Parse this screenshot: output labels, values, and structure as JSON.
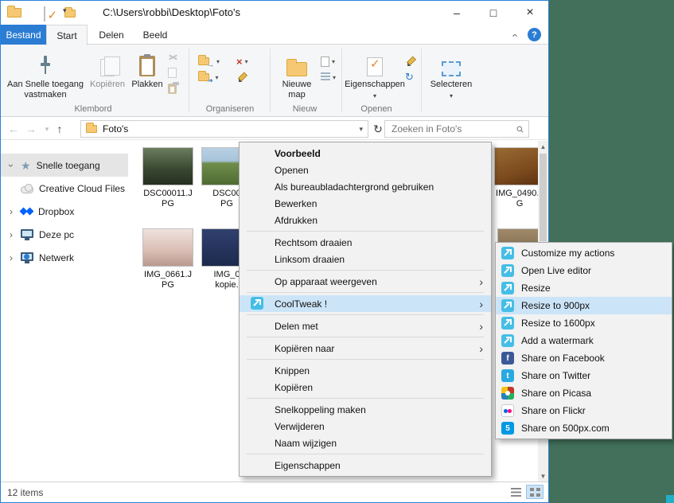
{
  "colors": {
    "accent_blue": "#2b7cd3",
    "desktop_green": "#42705a",
    "menu_highlight": "#cce4f7",
    "cooltweak_teal": "#45bee6"
  },
  "window": {
    "title": "C:\\Users\\robbi\\Desktop\\Foto's"
  },
  "tabs": [
    "Bestand",
    "Start",
    "Delen",
    "Beeld"
  ],
  "ribbon": {
    "pin": "Aan Snelle toegang vastmaken",
    "copy": "Kopiëren",
    "paste": "Plakken",
    "new_folder": "Nieuwe map",
    "properties": "Eigenschappen",
    "select": "Selecteren",
    "group_clipboard": "Klembord",
    "group_organize": "Organiseren",
    "group_new": "Nieuw",
    "group_open": "Openen"
  },
  "addressbar": {
    "location": "Foto's",
    "search_placeholder": "Zoeken in Foto's"
  },
  "sidebar": {
    "items": [
      {
        "label": "Snelle toegang"
      },
      {
        "label": "Creative Cloud Files"
      },
      {
        "label": "Dropbox"
      },
      {
        "label": "Deze pc"
      },
      {
        "label": "Netwerk"
      }
    ]
  },
  "files": [
    {
      "line1": "DSC00011.J",
      "line2": "PG"
    },
    {
      "line1": "DSC00",
      "line2": "PG"
    },
    {
      "line1": "IMG_0490.J",
      "line2": "G"
    },
    {
      "line1": "IMG_0661.J",
      "line2": "PG"
    },
    {
      "line1": "IMG_0",
      "line2": "kopie."
    }
  ],
  "context_menu": {
    "items": [
      {
        "label": "Voorbeeld"
      },
      {
        "label": "Openen"
      },
      {
        "label": "Als bureaubladachtergrond gebruiken"
      },
      {
        "label": "Bewerken"
      },
      {
        "label": "Afdrukken"
      },
      {
        "label": "Rechtsom draaien"
      },
      {
        "label": "Linksom draaien"
      },
      {
        "label": "Op apparaat weergeven"
      },
      {
        "label": "CoolTweak !"
      },
      {
        "label": "Delen met"
      },
      {
        "label": "Kopiëren naar"
      },
      {
        "label": "Knippen"
      },
      {
        "label": "Kopiëren"
      },
      {
        "label": "Snelkoppeling maken"
      },
      {
        "label": "Verwijderen"
      },
      {
        "label": "Naam wijzigen"
      },
      {
        "label": "Eigenschappen"
      }
    ]
  },
  "submenu": {
    "items": [
      {
        "label": "Customize my actions",
        "icon": "cooltweak-icon"
      },
      {
        "label": "Open Live editor",
        "icon": "cooltweak-icon"
      },
      {
        "label": "Resize",
        "icon": "cooltweak-icon"
      },
      {
        "label": "Resize to 900px",
        "icon": "cooltweak-icon"
      },
      {
        "label": "Resize to 1600px",
        "icon": "cooltweak-icon"
      },
      {
        "label": "Add a watermark",
        "icon": "cooltweak-icon"
      },
      {
        "label": "Share on Facebook",
        "icon": "facebook-icon"
      },
      {
        "label": "Share on Twitter",
        "icon": "twitter-icon"
      },
      {
        "label": "Share on Picasa",
        "icon": "picasa-icon"
      },
      {
        "label": "Share on Flickr",
        "icon": "flickr-icon"
      },
      {
        "label": "Share on 500px.com",
        "icon": "500px-icon"
      }
    ]
  },
  "statusbar": {
    "items_count": "12 items"
  }
}
